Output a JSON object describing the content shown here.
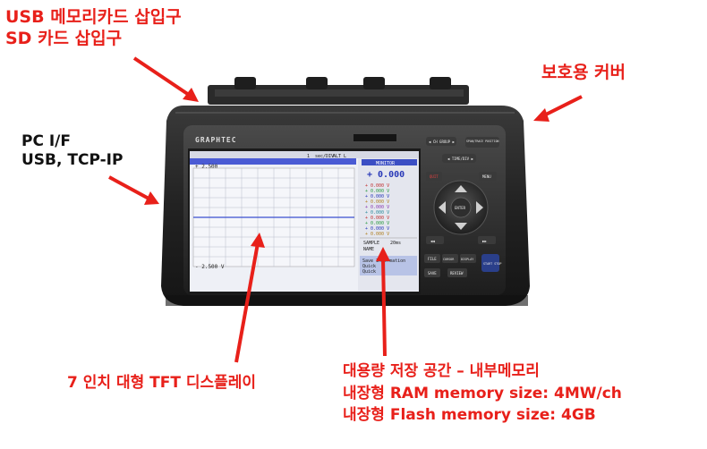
{
  "callouts": {
    "usb_card_slot": {
      "line1": "USB 메모리카드 삽입구",
      "line2": "SD 카드 삽입구"
    },
    "pc_interface": {
      "line1": "PC I/F",
      "line2": "USB, TCP-IP"
    },
    "protective_cover": {
      "label": "보호용 커버"
    },
    "tft_display": {
      "label": "7 인치 대형 TFT 디스플레이"
    },
    "internal_memory": {
      "line1": "대용량 저장 공간 – 내부메모리",
      "line2": "내장형 RAM memory size: 4MW/ch",
      "line3": "내장형 Flash memory size: 4GB"
    }
  },
  "device": {
    "brand": "GRAPHTEC",
    "screen": {
      "header_ch": "1",
      "header_timebase": "sec/DIV",
      "header_mode": "ALT L",
      "header_right": "MONITOR",
      "top_scale": "+ 2.500",
      "bottom_scale": "- 2.500 V",
      "monitor_label": "MONITOR",
      "big_reading": "+ 0.000",
      "channel_readings": [
        "+ 0.000 V",
        "+ 0.000 V",
        "+ 0.000 V",
        "+ 0.000 V",
        "+ 0.000 V",
        "+ 0.000 V",
        "+ 0.000 V",
        "+ 0.000 V",
        "+ 0.000 V",
        "+ 0.000 V"
      ],
      "sampling_label": "SAMPLE",
      "sampling_value": "20ms",
      "name_label": "NAME",
      "info_lines": [
        "Save Information",
        "Quick",
        "Quick"
      ]
    },
    "buttons": {
      "ch_group": "◀ CH GROUP ▶",
      "span_trace": "SPAN/TRACE POSITION",
      "time_div": "◀ TIME/DIV ▶",
      "quit": "QUIT",
      "menu": "MENU",
      "enter": "ENTER",
      "file": "FILE",
      "cursor": "CURSOR",
      "display": "DISPLAY",
      "review": "REVIEW",
      "start_stop": "START STOP",
      "save": "SAVE",
      "rew": "◀◀",
      "ff": "▶▶"
    }
  },
  "colors": {
    "callout_red": "#e8201a",
    "device_body": "#2b2b2b",
    "screen_bg": "#eef0f6",
    "grid_line": "#b8bccb",
    "trace": "#3a4fd0"
  }
}
